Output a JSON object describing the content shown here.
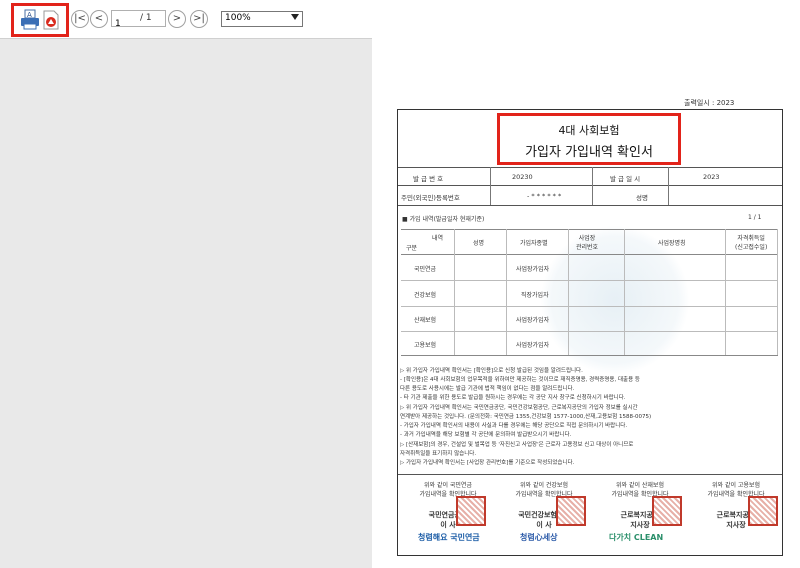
{
  "toolbar": {
    "page_current": "1",
    "page_total": "/ 1",
    "zoom": "100%",
    "nav_first": "|<",
    "nav_prev": "<",
    "nav_next": ">",
    "nav_last": ">|",
    "icons": [
      "print-icon",
      "pdf-icon"
    ]
  },
  "document": {
    "issued_label": "출력일시 : 2023",
    "title_line1": "4대 사회보험",
    "title_line2": "가입자 가입내역 확인서",
    "issue_no_label": "발 급 번 호",
    "issue_no_value": "20230",
    "issue_date_label": "발 급 일 시",
    "issue_date_value": "2023",
    "rrn_label": "주민(외국인)등록번호",
    "rrn_value": "- * * * * * *",
    "name_label": "성명",
    "section_label": "■ 가입 내역(발급일자 현재기준)",
    "page_counter": "1  /  1",
    "headers": {
      "content": "내역",
      "category": "구분",
      "name": "성명",
      "type": "가입자종별",
      "mgmt_no": "사업장\n관리번호",
      "workplace": "사업장명칭",
      "qual_date": "자격취득일\n(신고접수일)"
    },
    "rows": [
      {
        "category": "국민연금",
        "type": "사업장가입자"
      },
      {
        "category": "건강보험",
        "type": "직장가입자"
      },
      {
        "category": "산재보험",
        "type": "사업장가입자"
      },
      {
        "category": "고용보험",
        "type": "사업장가입자"
      }
    ],
    "notices": [
      "▷ 위 가입자 가입내역 확인서는 [확인용]으로 신청 발급된 것임을 알려드립니다.",
      "  - [확인용]은 4대 사회보험의 업무목적을 위하여만 제공하는 것이므로 재직증명용, 경력증명용, 대출용 등",
      "    다른 용도로 사용시에는 발급 기관에 법적 책임이 없다는 점을 알려드립니다.",
      "  - 타 기관 제출을 위한 용도로 발급을 원하시는 경우에는 각 공단 지사 창구로 신청하시기 바랍니다.",
      "▷ 위 가입자 가입내역 확인서는 국민연금공단, 국민건강보험공단, 근로복지공단의 가입자 정보를 실시간",
      "    연계받아 제공하는 것입니다. (문의전화: 국민연금 1355,건강보험 1577-1000,산재,고용보험 1588-0075)",
      "  - 가입자 가입내역 확인서의 내용이 사실과 다를 경우에는 해당 공단으로 직접 문의하시기 바랍니다.",
      "  - 과거 가입내역을 해당 보험별 각 공단에 문의하여 발급받으시기 바랍니다.",
      "▷ [산재보험]의 경우, 건설업 및 벌목업 등 '자진신고 사업장'은 근로자 고용정보 신고 대상이 아니므로",
      "    자격취득일을 표기하지 않습니다.",
      "▷ 가입자 가입내역 확인서는 [사업장 관리번호]를 기준으로 작성되었습니다."
    ],
    "signatures": [
      {
        "line1": "위와 같이 국민연금",
        "line2": "가입내역을 확인합니다",
        "org": "국민연금공단",
        "role": "이 사"
      },
      {
        "line1": "위와 같이 건강보험",
        "line2": "가입내역을 확인합니다",
        "org": "국민건강보험공단",
        "role": "이 사"
      },
      {
        "line1": "위와 같이 산재보험",
        "line2": "가입내역을 확인합니다",
        "org": "근로복지공단",
        "role": "지사장"
      },
      {
        "line1": "위와 같이 고용보험",
        "line2": "가입내역을 확인합니다",
        "org": "근로복지공단",
        "role": "지사장"
      }
    ],
    "logos": [
      "청렴해요 국민연금",
      "청렴心세상",
      "다가치 CLEAN"
    ]
  },
  "colors": {
    "highlight": "#e2231a",
    "seal": "#c0392b"
  }
}
